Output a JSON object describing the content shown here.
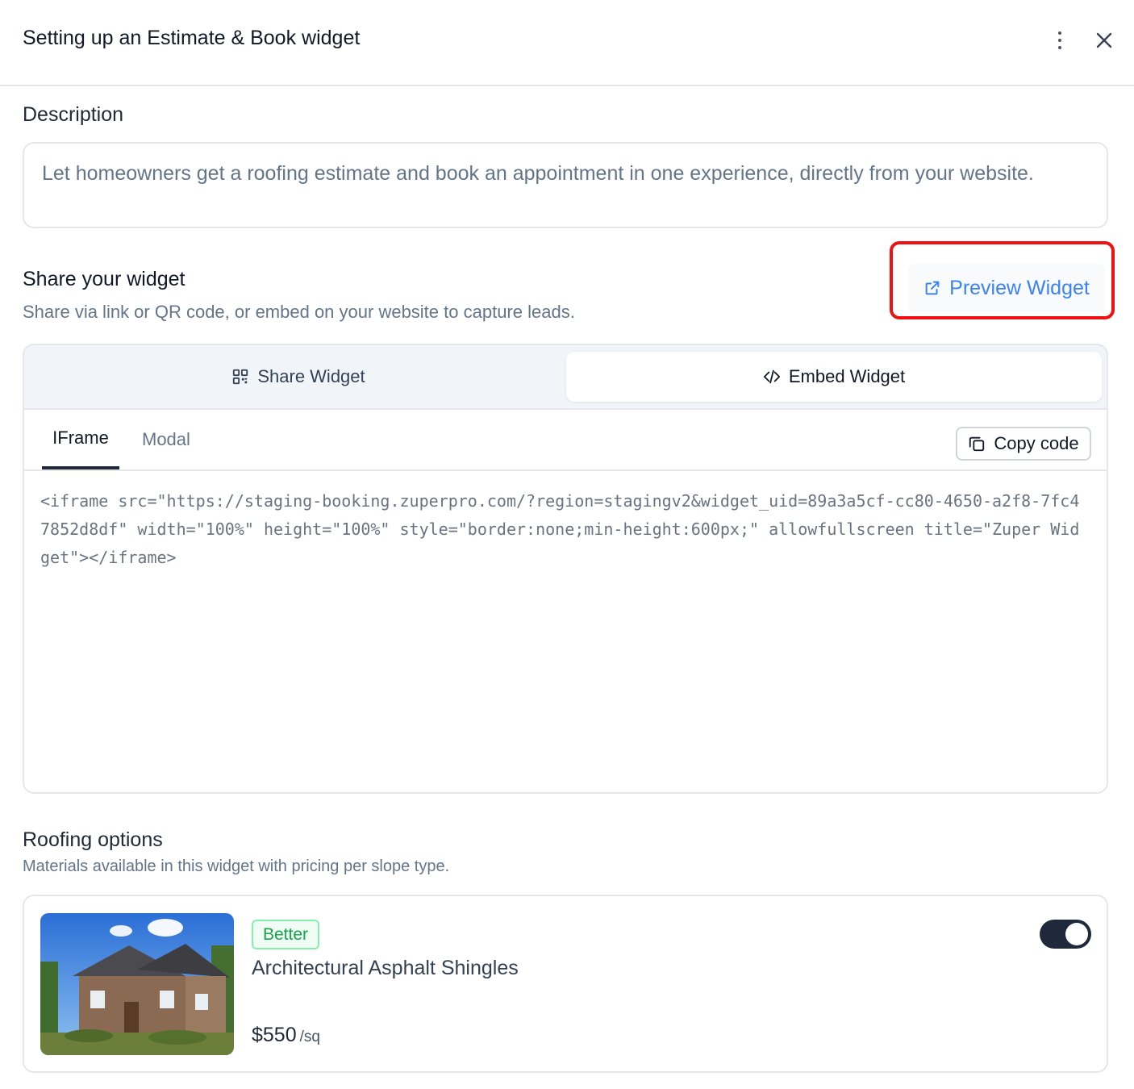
{
  "header": {
    "title": "Setting up an Estimate & Book widget"
  },
  "description": {
    "label": "Description",
    "text": "Let homeowners get a roofing estimate and book an appointment in one experience, directly from your website."
  },
  "share": {
    "title": "Share your widget",
    "subtitle": "Share via link or QR code, or embed on your website to capture leads.",
    "preview_label": "Preview Widget"
  },
  "segments": {
    "share_label": "Share Widget",
    "embed_label": "Embed Widget",
    "selected": "Embed Widget"
  },
  "embed": {
    "tabs": [
      "IFrame",
      "Modal"
    ],
    "active_tab": "IFrame",
    "copy_label": "Copy code",
    "code": "<iframe src=\"https://staging-booking.zuperpro.com/?region=stagingv2&widget_uid=89a3a5cf-cc80-4650-a2f8-7fc47852d8df\" width=\"100%\" height=\"100%\" style=\"border:none;min-height:600px;\" allowfullscreen title=\"Zuper Widget\"></iframe>"
  },
  "roofing": {
    "title": "Roofing options",
    "subtitle": "Materials available in this widget with pricing per slope type.",
    "options": [
      {
        "badge": "Better",
        "name": "Architectural Asphalt Shingles",
        "price": "$550",
        "unit": "/sq",
        "enabled": true
      }
    ]
  },
  "colors": {
    "accent": "#3b82f6",
    "highlight": "#ef1010",
    "badge_green": "#16a34a",
    "toggle_on": "#1e293b"
  }
}
